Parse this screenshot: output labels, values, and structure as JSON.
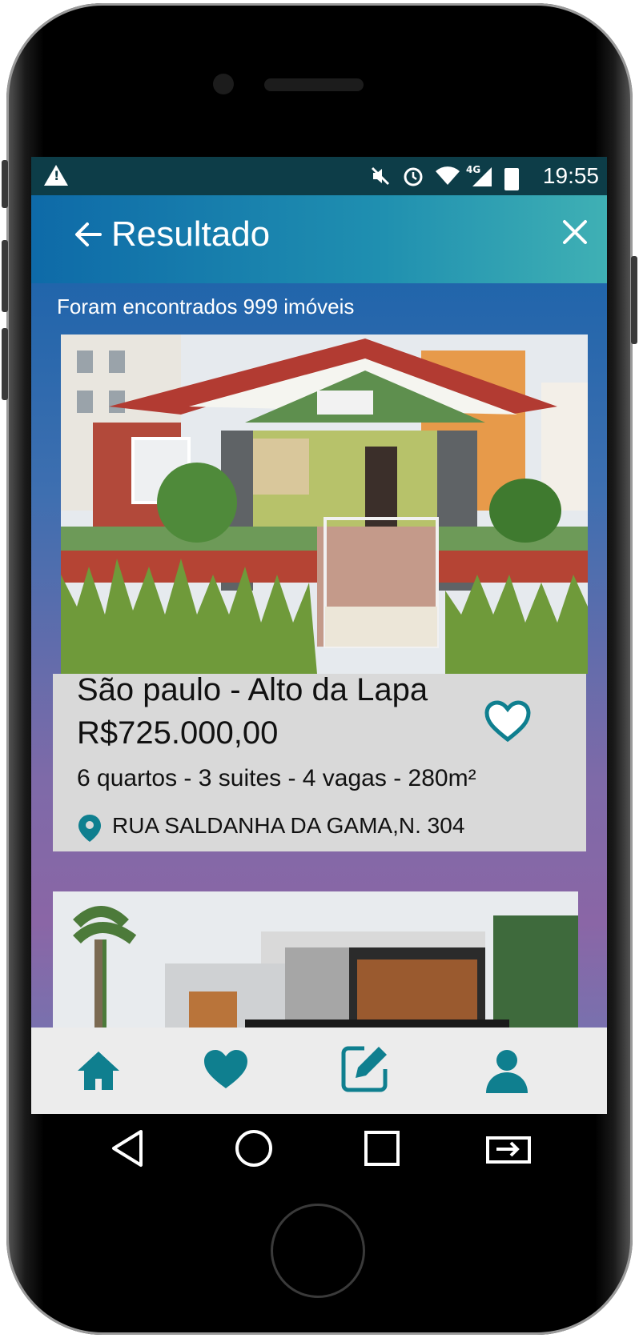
{
  "status_bar": {
    "time": "19:55",
    "network_label": "4G",
    "icons": [
      "warning-icon",
      "mute-icon",
      "alarm-icon",
      "wifi-icon",
      "signal-icon",
      "battery-icon"
    ]
  },
  "header": {
    "title": "Resultado",
    "back_icon": "arrow-left-icon",
    "close_icon": "close-icon"
  },
  "results": {
    "summary": "Foram encontrados 999 imóveis"
  },
  "listing": {
    "location": "São paulo - Alto da Lapa",
    "price": "R$725.000,00",
    "specs": "6 quartos - 3 suites - 4 vagas - 280m²",
    "address": "RUA SALDANHA DA GAMA,N. 304",
    "favorite_icon": "heart-outline-icon"
  },
  "bottom_nav": {
    "items": [
      "home-icon",
      "heart-icon",
      "edit-icon",
      "user-icon"
    ],
    "accent": "#0f7f8f"
  },
  "colors": {
    "status_bar": "#0d3d48",
    "card_bg": "#d9d9d9",
    "accent_teal": "#0f7f8f"
  }
}
